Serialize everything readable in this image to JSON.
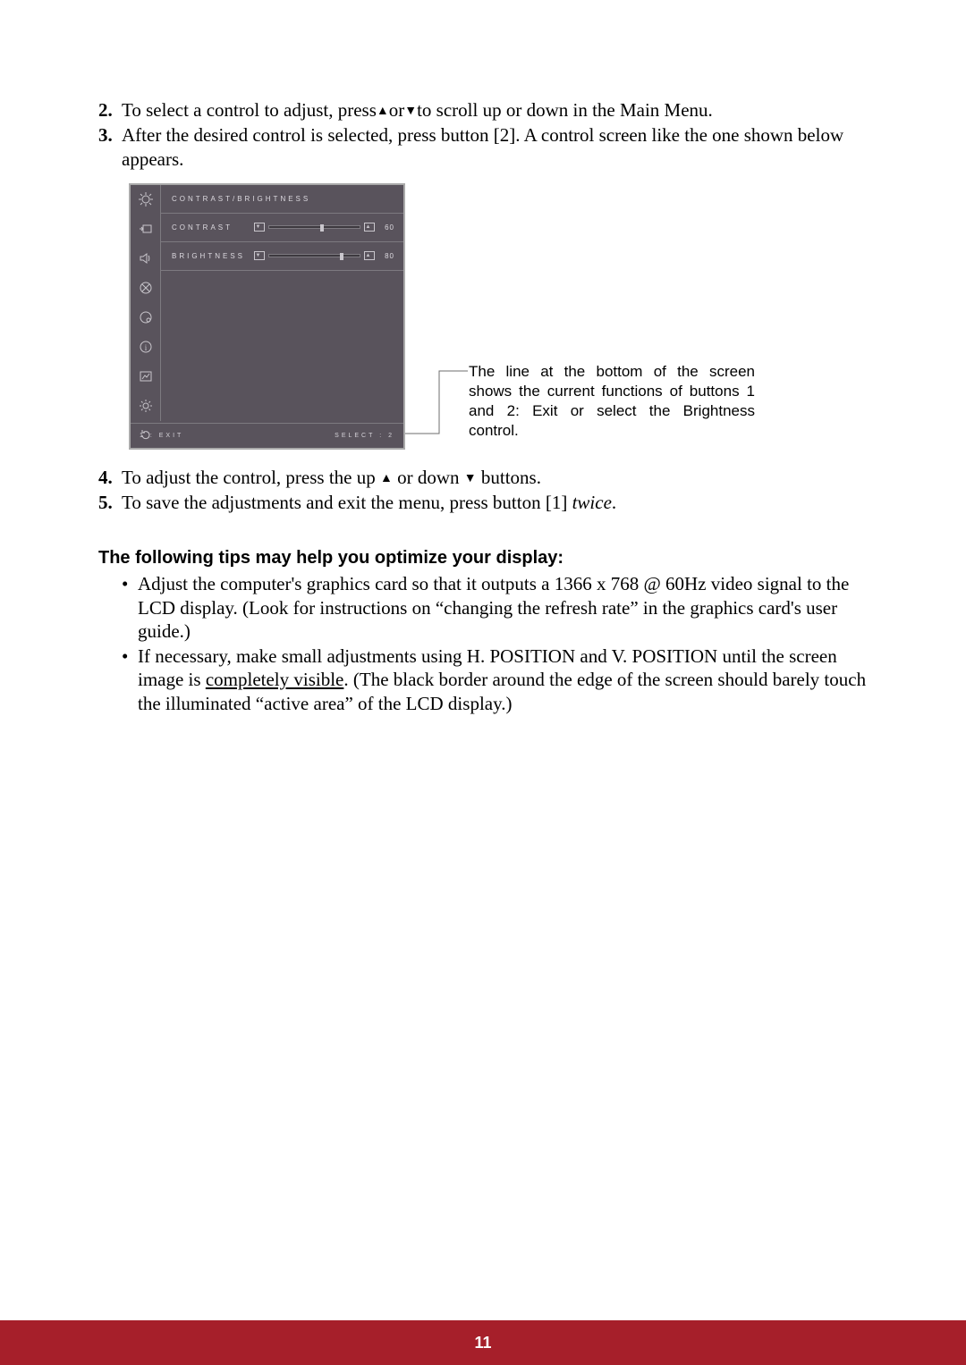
{
  "steps_a": [
    {
      "num": "2.",
      "parts": [
        "To select a control to adjust, press",
        "▲",
        "or",
        "▼",
        "to scroll up or down in the Main Menu."
      ]
    },
    {
      "num": "3.",
      "text": "After the desired control is selected, press button [2]. A control screen like the one shown below appears."
    }
  ],
  "osd": {
    "title": "CONTRAST/BRIGHTNESS",
    "rows": [
      {
        "label": "CONTRAST",
        "value": "60",
        "pos": 60
      },
      {
        "label": "BRIGHTNESS",
        "value": "80",
        "pos": 80
      }
    ],
    "status_left": "1 : EXIT",
    "status_right": "SELECT : 2"
  },
  "callout": "The line at the bottom of the screen shows the current functions of buttons 1 and 2: Exit or select the Brightness control.",
  "steps_b": [
    {
      "num": "4.",
      "parts": [
        "To adjust the control, press the up ",
        "▲",
        " or down ",
        "▼",
        " buttons."
      ]
    },
    {
      "num": "5.",
      "parts": [
        "To save the adjustments and exit the menu, press button [1] ",
        "twice",
        "."
      ]
    }
  ],
  "tips_heading": "The following tips may help you optimize your display:",
  "tips": [
    {
      "text": "Adjust the computer's graphics card so that it outputs a 1366 x 768 @ 60Hz video signal to the LCD display. (Look for instructions on “changing the refresh rate” in the graphics card's user guide.)"
    },
    {
      "pre": "If necessary, make small adjustments using H. POSITION and V. POSITION until the screen image is ",
      "u": "completely visible",
      "post": ". (The black border around the edge of the screen should barely touch the illuminated “active area” of the LCD display.)"
    }
  ],
  "page_number": "11"
}
